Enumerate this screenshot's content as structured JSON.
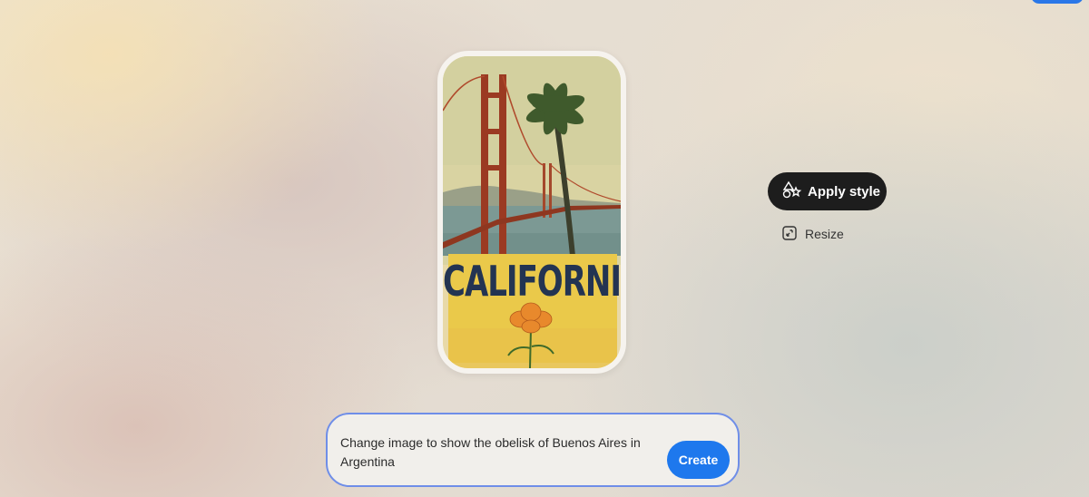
{
  "image_card": {
    "poster_word": "CALIFORNIA"
  },
  "actions": {
    "apply_style_label": "Apply style",
    "resize_label": "Resize",
    "apply_style_icon": "shapes-icon",
    "resize_icon": "resize-icon"
  },
  "prompt": {
    "text": "Change image to show the obelisk of Buenos Aires in Argentina",
    "create_label": "Create"
  },
  "colors": {
    "accent": "#1e78ed",
    "dark_button": "#1d1d1d",
    "prompt_border": "#6f8ee8"
  }
}
